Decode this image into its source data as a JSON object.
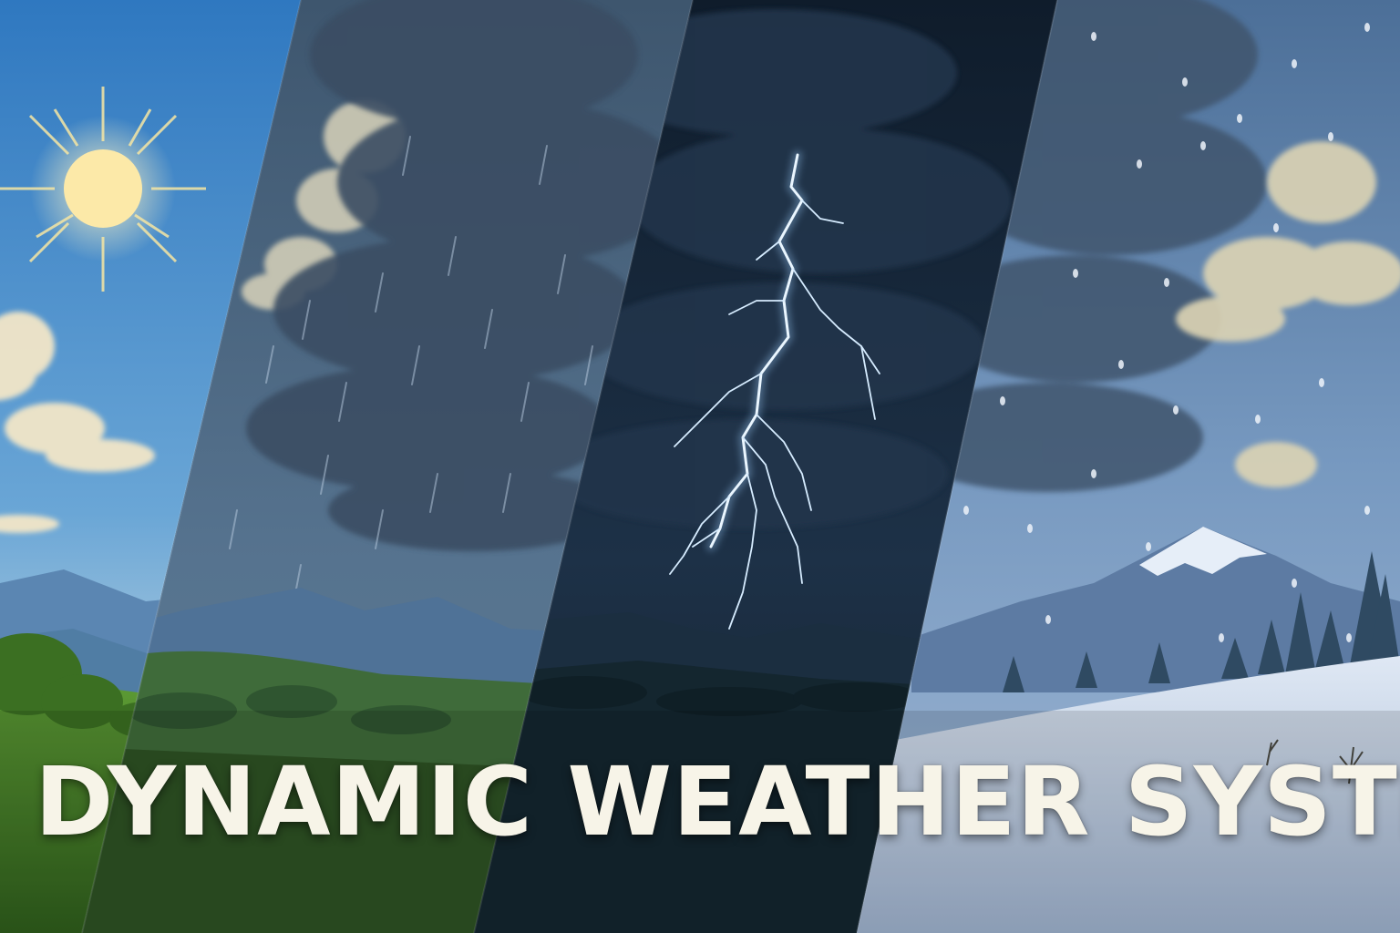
{
  "banner": {
    "title": "DYNAMIC WEATHER SYSTEM"
  },
  "panels": [
    {
      "name": "sunny",
      "icon": "sun-icon"
    },
    {
      "name": "rain",
      "icon": "rain-icon"
    },
    {
      "name": "thunderstorm",
      "icon": "lightning-icon"
    },
    {
      "name": "snow",
      "icon": "snow-icon"
    }
  ],
  "colors": {
    "title_text": "#f7f4e8",
    "sunny_sky": "#3f86c8",
    "rain_sky": "#46627f",
    "storm_sky": "#17283c",
    "snow_sky": "#5a7ea6",
    "lightning": "#e8f4ff",
    "grass": "#4f8f2e",
    "snow_ground": "#cfdcef"
  }
}
